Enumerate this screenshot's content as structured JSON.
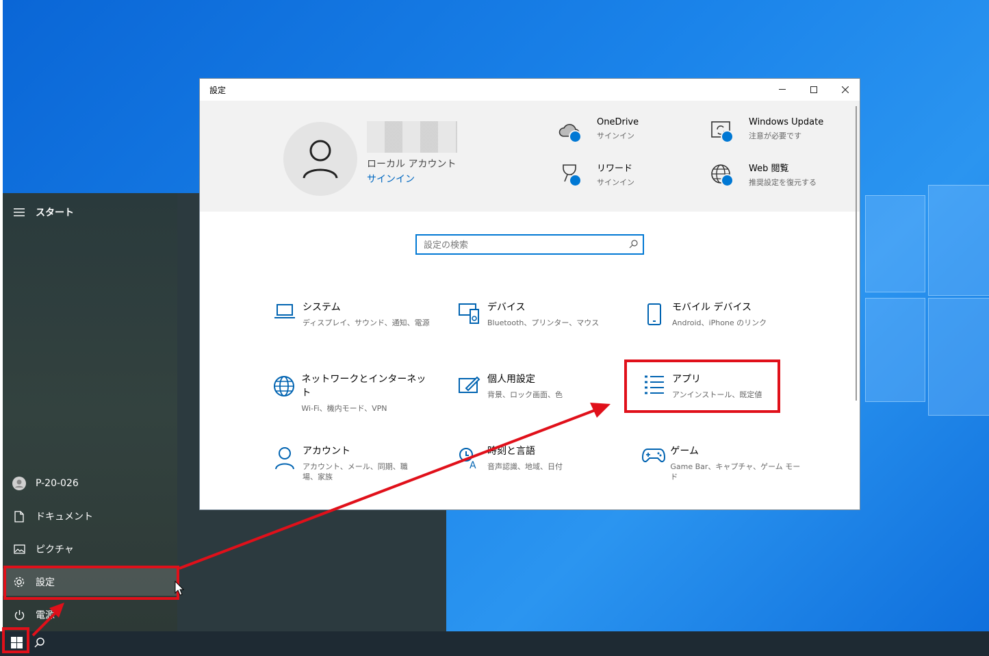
{
  "start_menu": {
    "header": "スタート",
    "user": "P-20-026",
    "documents": "ドキュメント",
    "pictures": "ピクチャ",
    "settings": "設定",
    "power": "電源"
  },
  "settings_window": {
    "title": "設定",
    "controls": {
      "minimize": "—",
      "maximize": "☐",
      "close": "✕"
    },
    "account": {
      "type": "ローカル アカウント",
      "signin": "サインイン"
    },
    "quick_links": [
      {
        "title": "OneDrive",
        "sub": "サインイン"
      },
      {
        "title": "Windows Update",
        "sub": "注意が必要です"
      },
      {
        "title": "リワード",
        "sub": "サインイン"
      },
      {
        "title": "Web 閲覧",
        "sub": "推奨設定を復元する"
      }
    ],
    "search_placeholder": "設定の検索",
    "categories": [
      {
        "title": "システム",
        "sub": "ディスプレイ、サウンド、通知、電源"
      },
      {
        "title": "デバイス",
        "sub": "Bluetooth、プリンター、マウス"
      },
      {
        "title": "モバイル デバイス",
        "sub": "Android、iPhone のリンク"
      },
      {
        "title": "ネットワークとインターネット",
        "sub": "Wi-Fi、機内モード、VPN"
      },
      {
        "title": "個人用設定",
        "sub": "背景、ロック画面、色"
      },
      {
        "title": "アプリ",
        "sub": "アンインストール、既定値"
      },
      {
        "title": "アカウント",
        "sub": "アカウント、メール、同期、職場、家族"
      },
      {
        "title": "時刻と言語",
        "sub": "音声認識、地域、日付"
      },
      {
        "title": "ゲーム",
        "sub": "Game Bar、キャプチャ、ゲーム モード"
      }
    ]
  },
  "colors": {
    "accent": "#0078d4",
    "highlight": "#e0101a"
  }
}
